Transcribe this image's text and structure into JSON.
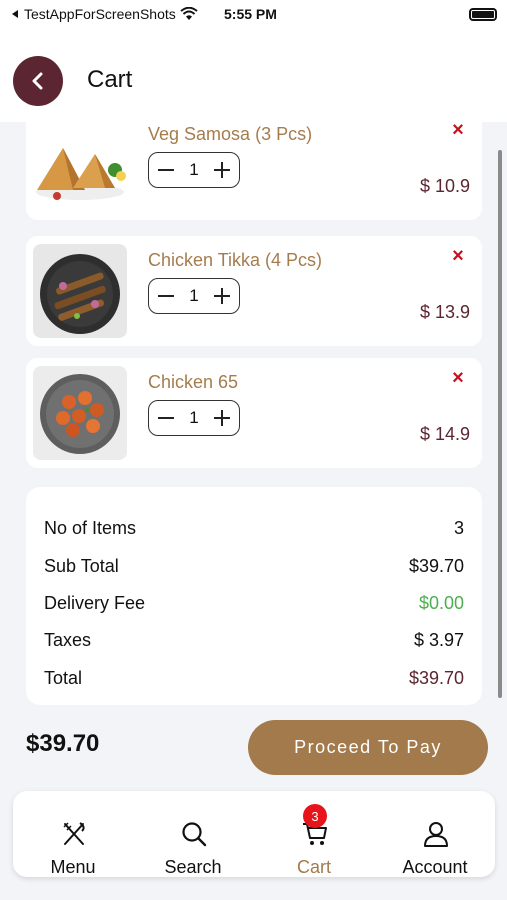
{
  "status_bar": {
    "carrier": "TestAppForScreenShots",
    "time": "5:55 PM"
  },
  "header": {
    "title": "Cart"
  },
  "cart_items": [
    {
      "name": "Veg Samosa (3 Pcs)",
      "qty": "1",
      "price": "$ 10.9",
      "remove": "×"
    },
    {
      "name": "Chicken Tikka (4 Pcs)",
      "qty": "1",
      "price": "$ 13.9",
      "remove": "×"
    },
    {
      "name": "Chicken 65",
      "qty": "1",
      "price": "$ 14.9",
      "remove": "×"
    }
  ],
  "summary": {
    "items": {
      "label": "No of Items",
      "value": "3"
    },
    "subtotal": {
      "label": "Sub Total",
      "value": "$39.70"
    },
    "delivery": {
      "label": "Delivery Fee",
      "value": "$0.00"
    },
    "taxes": {
      "label": "Taxes",
      "value": "$ 3.97"
    },
    "total": {
      "label": "Total",
      "value": "$39.70"
    }
  },
  "footer": {
    "total": "$39.70",
    "proceed_label": "Proceed To Pay"
  },
  "tabs": [
    {
      "label": "Menu",
      "icon": "utensils-icon"
    },
    {
      "label": "Search",
      "icon": "search-icon"
    },
    {
      "label": "Cart",
      "icon": "cart-icon",
      "badge": "3"
    },
    {
      "label": "Account",
      "icon": "account-icon"
    }
  ],
  "colors": {
    "brand": "#5b2631",
    "accent": "#a27a4c",
    "remove": "#c8101c",
    "free": "#4caf50",
    "badge": "#e8141c"
  }
}
